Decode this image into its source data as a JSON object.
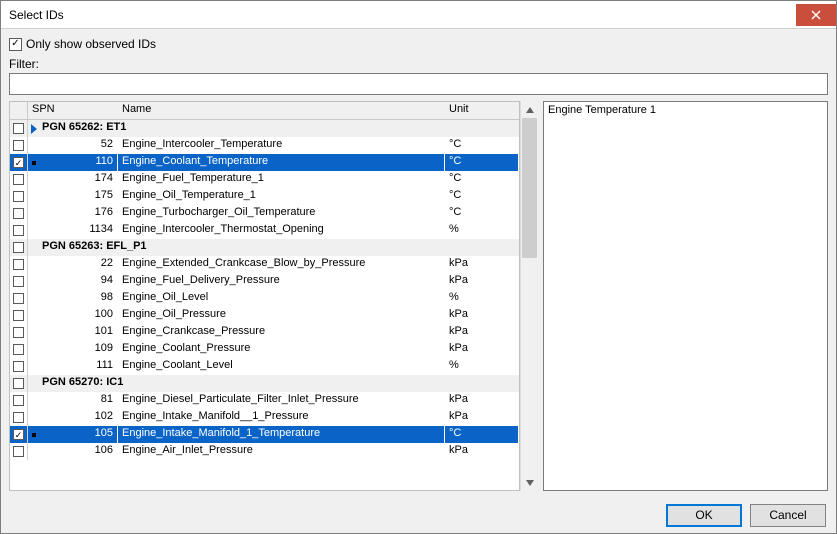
{
  "title": "Select IDs",
  "checkbox": {
    "label": "Only show observed IDs",
    "checked": true
  },
  "filter": {
    "label": "Filter:",
    "value": ""
  },
  "columns": {
    "spn": "SPN",
    "name": "Name",
    "unit": "Unit"
  },
  "rows": [
    {
      "type": "group",
      "label": "PGN 65262: ET1",
      "indicator": "triangle",
      "checked": false
    },
    {
      "type": "item",
      "spn": "52",
      "name": "Engine_Intercooler_Temperature",
      "unit": "°C",
      "checked": false,
      "selected": false
    },
    {
      "type": "item",
      "spn": "110",
      "name": "Engine_Coolant_Temperature",
      "unit": "°C",
      "checked": true,
      "selected": true,
      "indicator": "dot"
    },
    {
      "type": "item",
      "spn": "174",
      "name": "Engine_Fuel_Temperature_1",
      "unit": "°C",
      "checked": false,
      "selected": false
    },
    {
      "type": "item",
      "spn": "175",
      "name": "Engine_Oil_Temperature_1",
      "unit": "°C",
      "checked": false,
      "selected": false
    },
    {
      "type": "item",
      "spn": "176",
      "name": "Engine_Turbocharger_Oil_Temperature",
      "unit": "°C",
      "checked": false,
      "selected": false
    },
    {
      "type": "item",
      "spn": "1134",
      "name": "Engine_Intercooler_Thermostat_Opening",
      "unit": "%",
      "checked": false,
      "selected": false
    },
    {
      "type": "group",
      "label": "PGN 65263: EFL_P1",
      "checked": false
    },
    {
      "type": "item",
      "spn": "22",
      "name": "Engine_Extended_Crankcase_Blow_by_Pressure",
      "unit": "kPa",
      "checked": false,
      "selected": false
    },
    {
      "type": "item",
      "spn": "94",
      "name": "Engine_Fuel_Delivery_Pressure",
      "unit": "kPa",
      "checked": false,
      "selected": false
    },
    {
      "type": "item",
      "spn": "98",
      "name": "Engine_Oil_Level",
      "unit": "%",
      "checked": false,
      "selected": false
    },
    {
      "type": "item",
      "spn": "100",
      "name": "Engine_Oil_Pressure",
      "unit": "kPa",
      "checked": false,
      "selected": false
    },
    {
      "type": "item",
      "spn": "101",
      "name": "Engine_Crankcase_Pressure",
      "unit": "kPa",
      "checked": false,
      "selected": false
    },
    {
      "type": "item",
      "spn": "109",
      "name": "Engine_Coolant_Pressure",
      "unit": "kPa",
      "checked": false,
      "selected": false
    },
    {
      "type": "item",
      "spn": "111",
      "name": "Engine_Coolant_Level",
      "unit": "%",
      "checked": false,
      "selected": false
    },
    {
      "type": "group",
      "label": "PGN 65270: IC1",
      "checked": false
    },
    {
      "type": "item",
      "spn": "81",
      "name": "Engine_Diesel_Particulate_Filter_Inlet_Pressure",
      "unit": "kPa",
      "checked": false,
      "selected": false
    },
    {
      "type": "item",
      "spn": "102",
      "name": "Engine_Intake_Manifold__1_Pressure",
      "unit": "kPa",
      "checked": false,
      "selected": false
    },
    {
      "type": "item",
      "spn": "105",
      "name": "Engine_Intake_Manifold_1_Temperature",
      "unit": "°C",
      "checked": true,
      "selected": true,
      "indicator": "dot"
    },
    {
      "type": "item",
      "spn": "106",
      "name": "Engine_Air_Inlet_Pressure",
      "unit": "kPa",
      "checked": false,
      "selected": false
    }
  ],
  "detail": "Engine Temperature 1",
  "buttons": {
    "ok": "OK",
    "cancel": "Cancel"
  }
}
